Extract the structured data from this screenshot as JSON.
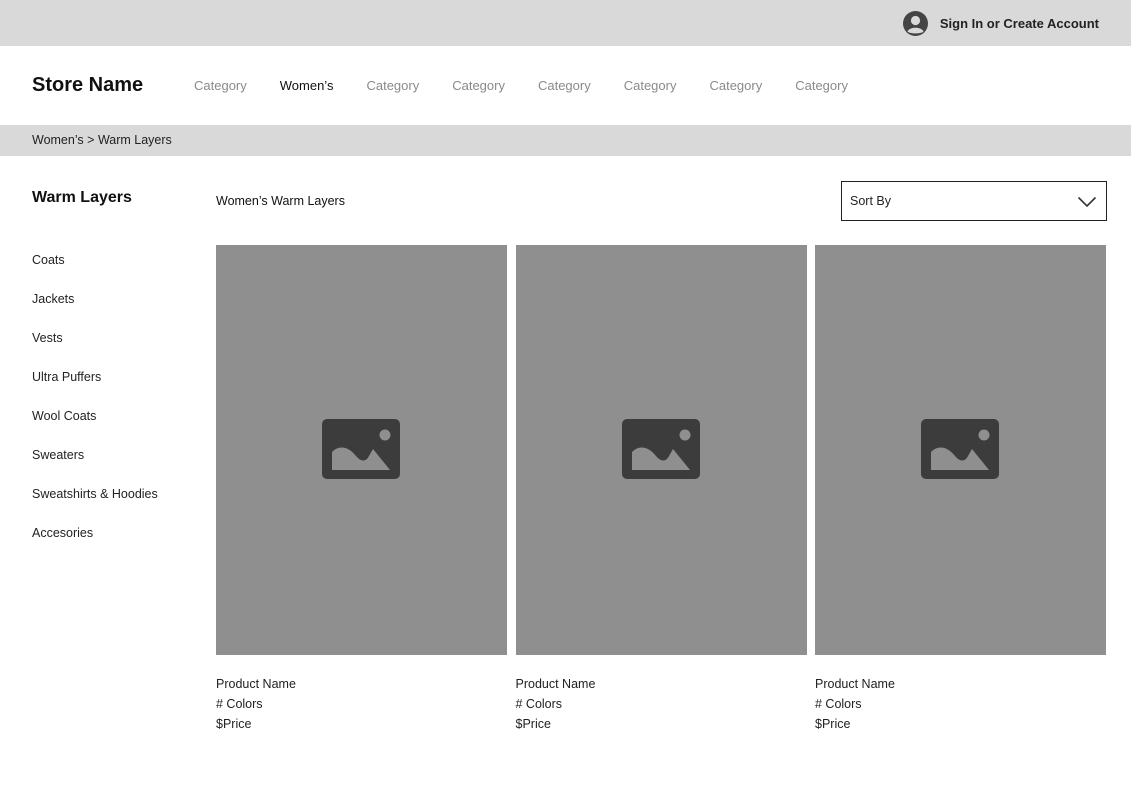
{
  "topbar": {
    "account_label": "Sign In or Create Account",
    "account_icon": "user-avatar-icon"
  },
  "header": {
    "store_name": "Store Name",
    "nav": [
      {
        "label": "Category",
        "active": false
      },
      {
        "label": "Women’s",
        "active": true
      },
      {
        "label": "Category",
        "active": false
      },
      {
        "label": "Category",
        "active": false
      },
      {
        "label": "Category",
        "active": false
      },
      {
        "label": "Category",
        "active": false
      },
      {
        "label": "Category",
        "active": false
      },
      {
        "label": "Category",
        "active": false
      }
    ]
  },
  "breadcrumb": {
    "items": [
      "Women’s",
      "Warm Layers"
    ],
    "separator": ">"
  },
  "sidebar": {
    "title": "Warm Layers",
    "items": [
      {
        "label": "Coats"
      },
      {
        "label": "Jackets"
      },
      {
        "label": "Vests"
      },
      {
        "label": "Ultra Puffers"
      },
      {
        "label": "Wool Coats"
      },
      {
        "label": "Sweaters"
      },
      {
        "label": "Sweatshirts & Hoodies"
      },
      {
        "label": "Accesories"
      }
    ]
  },
  "main": {
    "title": "Women’s Warm Layers",
    "sort": {
      "label": "Sort By",
      "icon": "chevron-down-icon"
    },
    "products": [
      {
        "name": "Product Name",
        "colors": "# Colors",
        "price": "$Price",
        "icon": "image-placeholder-icon"
      },
      {
        "name": "Product Name",
        "colors": "# Colors",
        "price": "$Price",
        "icon": "image-placeholder-icon"
      },
      {
        "name": "Product Name",
        "colors": "# Colors",
        "price": "$Price",
        "icon": "image-placeholder-icon"
      }
    ]
  },
  "colors": {
    "bars": "#d9d9d9",
    "placeholder": "#8f8f8f",
    "icon": "#3c3c3c",
    "inactive_nav": "#8a8a8a"
  }
}
